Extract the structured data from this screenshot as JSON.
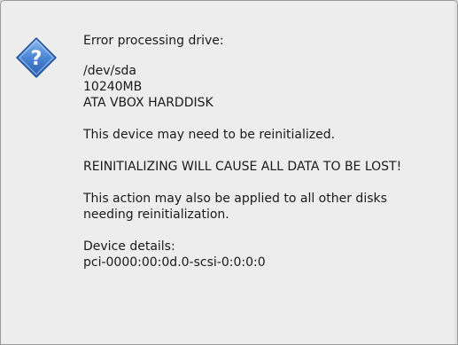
{
  "dialog": {
    "icon": "question-icon",
    "title_line": "Error processing drive:",
    "drive": {
      "path": "/dev/sda",
      "size": "10240MB",
      "model": "ATA VBOX HARDDISK"
    },
    "reinit_notice": "This device may need to be reinitialized.",
    "warning": "REINITIALIZING WILL CAUSE ALL DATA TO BE LOST!",
    "apply_all_line1": "This action may also be applied to all other disks",
    "apply_all_line2": "needing reinitialization.",
    "details_label": "Device details:",
    "details_value": "pci-0000:00:0d.0-scsi-0:0:0:0",
    "colors": {
      "icon_fill": "#3a74c8",
      "icon_border": "#1f4f99",
      "background": "#ededed"
    }
  }
}
